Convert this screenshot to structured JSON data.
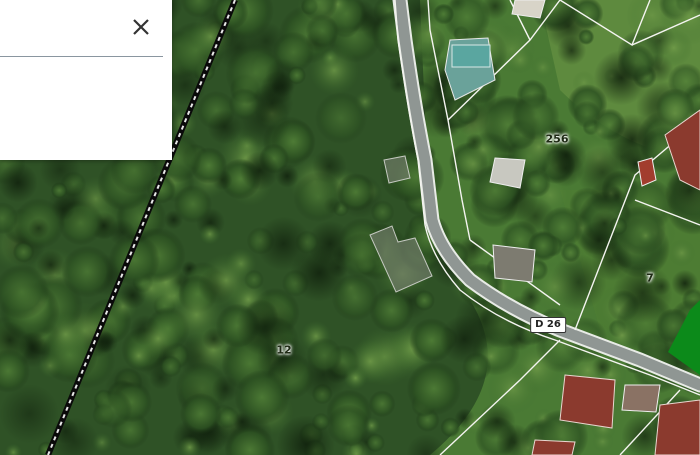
{
  "map": {
    "parcel_numbers": [
      {
        "text": "256",
        "id": "parcel-256"
      },
      {
        "text": "7",
        "id": "parcel-7"
      },
      {
        "text": "12",
        "id": "parcel-12"
      }
    ],
    "road_label": "D 26"
  },
  "panel": {
    "close_icon": "close-icon"
  },
  "colors": {
    "vegetation_dark": "#1f3a1a",
    "vegetation_mid": "#3c6b2c",
    "road": "#9aa09c",
    "parcel_boundary": "#f2f2ee",
    "highlight_parcel": "#0c8a1a",
    "roof_red": "#8b3a2e",
    "pool": "#5aa6a0"
  }
}
